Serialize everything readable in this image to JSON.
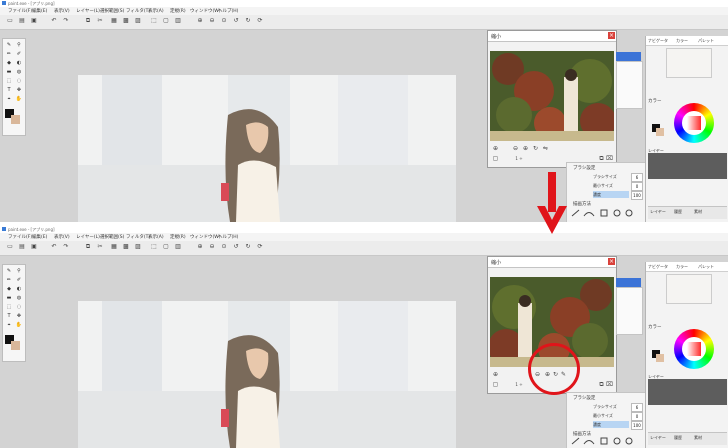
{
  "window_title": "paint.exe - [アプリ.png]",
  "menu": [
    "ファイル(F)",
    "編集(E)",
    "表示(V)",
    "レイヤー(L)",
    "選択範囲(S)",
    "フィルタ(T)",
    "表示(A)",
    "定規(R)",
    "ウィンドウ(W)",
    "ヘルプ(H)"
  ],
  "navigator": {
    "tab": "縮小",
    "close": "×",
    "zoom_value": "1 ÷"
  },
  "brush_panel": {
    "title": "ブラシ設定",
    "rows": [
      {
        "label": "ブラシサイズ",
        "value": "6"
      },
      {
        "label": "最小サイズ",
        "value": "0"
      },
      {
        "label": "濃度",
        "value": "100"
      }
    ],
    "shapes_title": "描画方法"
  },
  "right_panel": {
    "tabs": [
      "ナビゲータ",
      "カラー",
      "パレット"
    ],
    "color_head": "カラー",
    "layer_head": "レイヤー",
    "layer_tabs": [
      "レイヤー",
      "履歴",
      "素材"
    ]
  },
  "colors": {
    "arrow": "#e0141a",
    "highlight": "#3b73d7"
  },
  "icons": [
    "pen-icon",
    "brush-icon",
    "eraser-icon",
    "zoom-in-icon",
    "zoom-out-icon",
    "rotate-icon",
    "eyedropper-icon",
    "hand-icon"
  ]
}
